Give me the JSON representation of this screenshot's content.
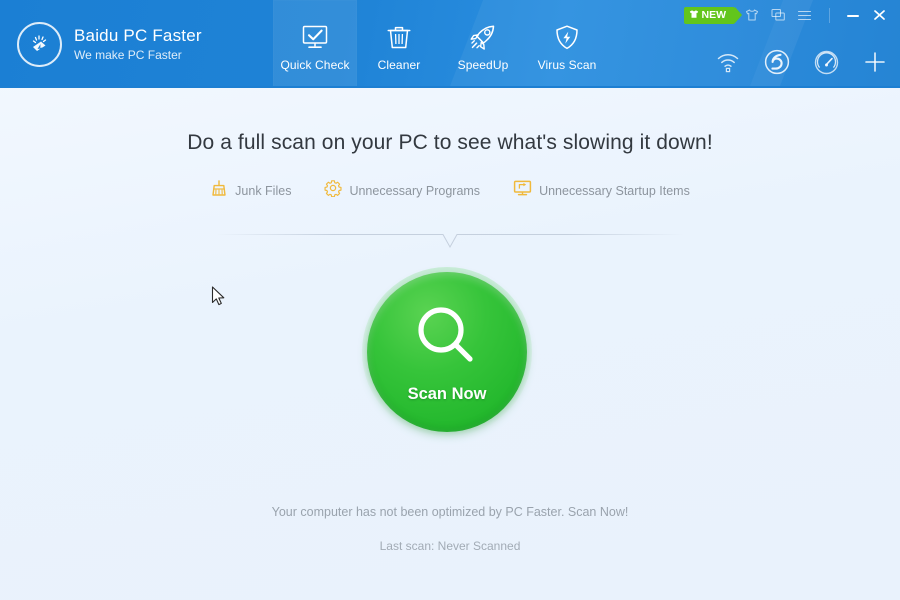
{
  "window": {
    "minimize_label": "—",
    "close_label": "×"
  },
  "brand": {
    "title": "Baidu PC Faster",
    "tagline": "We make PC Faster",
    "logo_icon": "broom-lightning-icon"
  },
  "nav": {
    "items": [
      {
        "label": "Quick Check",
        "icon": "monitor-check-icon",
        "active": true
      },
      {
        "label": "Cleaner",
        "icon": "trash-can-icon",
        "active": false
      },
      {
        "label": "SpeedUp",
        "icon": "rocket-icon",
        "active": false
      },
      {
        "label": "Virus Scan",
        "icon": "shield-bolt-icon",
        "active": false
      }
    ]
  },
  "top_right": {
    "new_badge_label": "NEW",
    "new_badge_icon": "tshirt-icon",
    "new_badge_color": "#62c51c",
    "skin_icon": "tshirt-icon",
    "feedback_icon": "feedback-chat-icon",
    "menu_icon": "hamburger-menu-icon"
  },
  "header_tools": {
    "items": [
      {
        "icon": "wifi-icon",
        "name": "wifi"
      },
      {
        "icon": "baidu-paw-icon",
        "name": "baidu"
      },
      {
        "icon": "speedometer-icon",
        "name": "speedometer"
      },
      {
        "icon": "plus-icon",
        "name": "add"
      }
    ]
  },
  "main": {
    "headline": "Do a full scan on your PC to see what's slowing it down!",
    "features": [
      {
        "label": "Junk Files",
        "icon": "broom-icon",
        "color": "#f0b93c"
      },
      {
        "label": "Unnecessary Programs",
        "icon": "gear-icon",
        "color": "#f0b93c"
      },
      {
        "label": "Unnecessary Startup Items",
        "icon": "monitor-icon",
        "color": "#f0b93c"
      }
    ],
    "scan_button": {
      "label": "Scan Now",
      "icon": "magnifier-icon",
      "color": "#2fc137"
    },
    "status_note": "Your computer has not been optimized by PC Faster. Scan Now!",
    "last_scan": "Last scan:  Never Scanned"
  },
  "theme": {
    "header_blue": "#1f83d6",
    "page_bg": "#eaf3fd",
    "accent_gold": "#f0b93c",
    "accent_green": "#2fc137"
  }
}
